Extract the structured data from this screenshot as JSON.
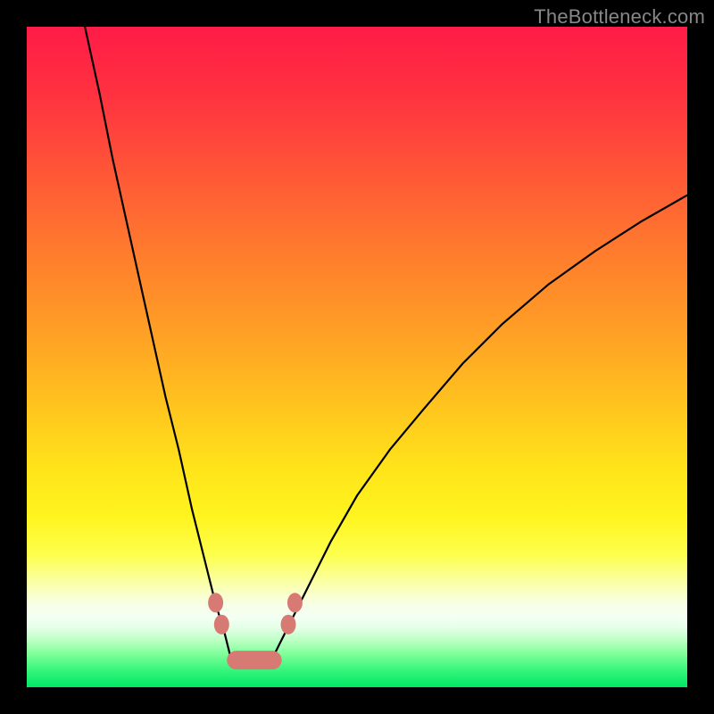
{
  "watermark": "TheBottleneck.com",
  "colors": {
    "frame": "#000000",
    "watermark_text": "#878787",
    "curve_stroke": "#000000",
    "marker_fill": "#d87a74",
    "gradient_stops": [
      {
        "offset": 0.0,
        "color": "#ff1c47"
      },
      {
        "offset": 0.1,
        "color": "#ff3140"
      },
      {
        "offset": 0.22,
        "color": "#ff5637"
      },
      {
        "offset": 0.35,
        "color": "#ff7e2d"
      },
      {
        "offset": 0.48,
        "color": "#ffa524"
      },
      {
        "offset": 0.58,
        "color": "#ffc61e"
      },
      {
        "offset": 0.67,
        "color": "#ffe41a"
      },
      {
        "offset": 0.74,
        "color": "#fff41e"
      },
      {
        "offset": 0.8,
        "color": "#fdff4d"
      },
      {
        "offset": 0.845,
        "color": "#faffae"
      },
      {
        "offset": 0.875,
        "color": "#f8ffe8"
      },
      {
        "offset": 0.895,
        "color": "#f4fff4"
      },
      {
        "offset": 0.91,
        "color": "#e4ffe7"
      },
      {
        "offset": 0.93,
        "color": "#b9ffc1"
      },
      {
        "offset": 0.95,
        "color": "#7dff99"
      },
      {
        "offset": 0.975,
        "color": "#34f57b"
      },
      {
        "offset": 1.0,
        "color": "#00e765"
      }
    ]
  },
  "chart_data": {
    "type": "line",
    "title": "",
    "xlabel": "",
    "ylabel": "",
    "xlim": [
      0,
      100
    ],
    "ylim": [
      0,
      100
    ],
    "note": "Values are approximate percentages read from pixel positions. Y=0 is bottom (optimal), Y=100 is top (severe bottleneck). Two branches of a V-shaped curve meet near x≈31–37 at y≈4.",
    "series": [
      {
        "name": "left-branch",
        "x": [
          8.8,
          11,
          13,
          15,
          17,
          19,
          21,
          23,
          25,
          27,
          28.5,
          30,
          31
        ],
        "y": [
          100,
          90,
          80,
          71,
          62,
          53,
          44,
          36,
          27,
          19,
          13,
          8,
          4
        ]
      },
      {
        "name": "right-branch",
        "x": [
          37,
          39,
          42,
          46,
          50,
          55,
          60,
          66,
          72,
          79,
          86,
          93,
          100
        ],
        "y": [
          4,
          8,
          14,
          22,
          29,
          36,
          42,
          49,
          55,
          61,
          66,
          70.5,
          74.5
        ]
      }
    ],
    "markers": {
      "name": "highlight",
      "shape": "rounded-capsule",
      "points": [
        {
          "x": 28.6,
          "y": 12.8
        },
        {
          "x": 29.5,
          "y": 9.5
        },
        {
          "x": 39.6,
          "y": 9.5
        },
        {
          "x": 40.6,
          "y": 12.8
        }
      ],
      "bar": {
        "x_start": 30.3,
        "x_end": 38.6,
        "y": 4.1
      }
    }
  }
}
